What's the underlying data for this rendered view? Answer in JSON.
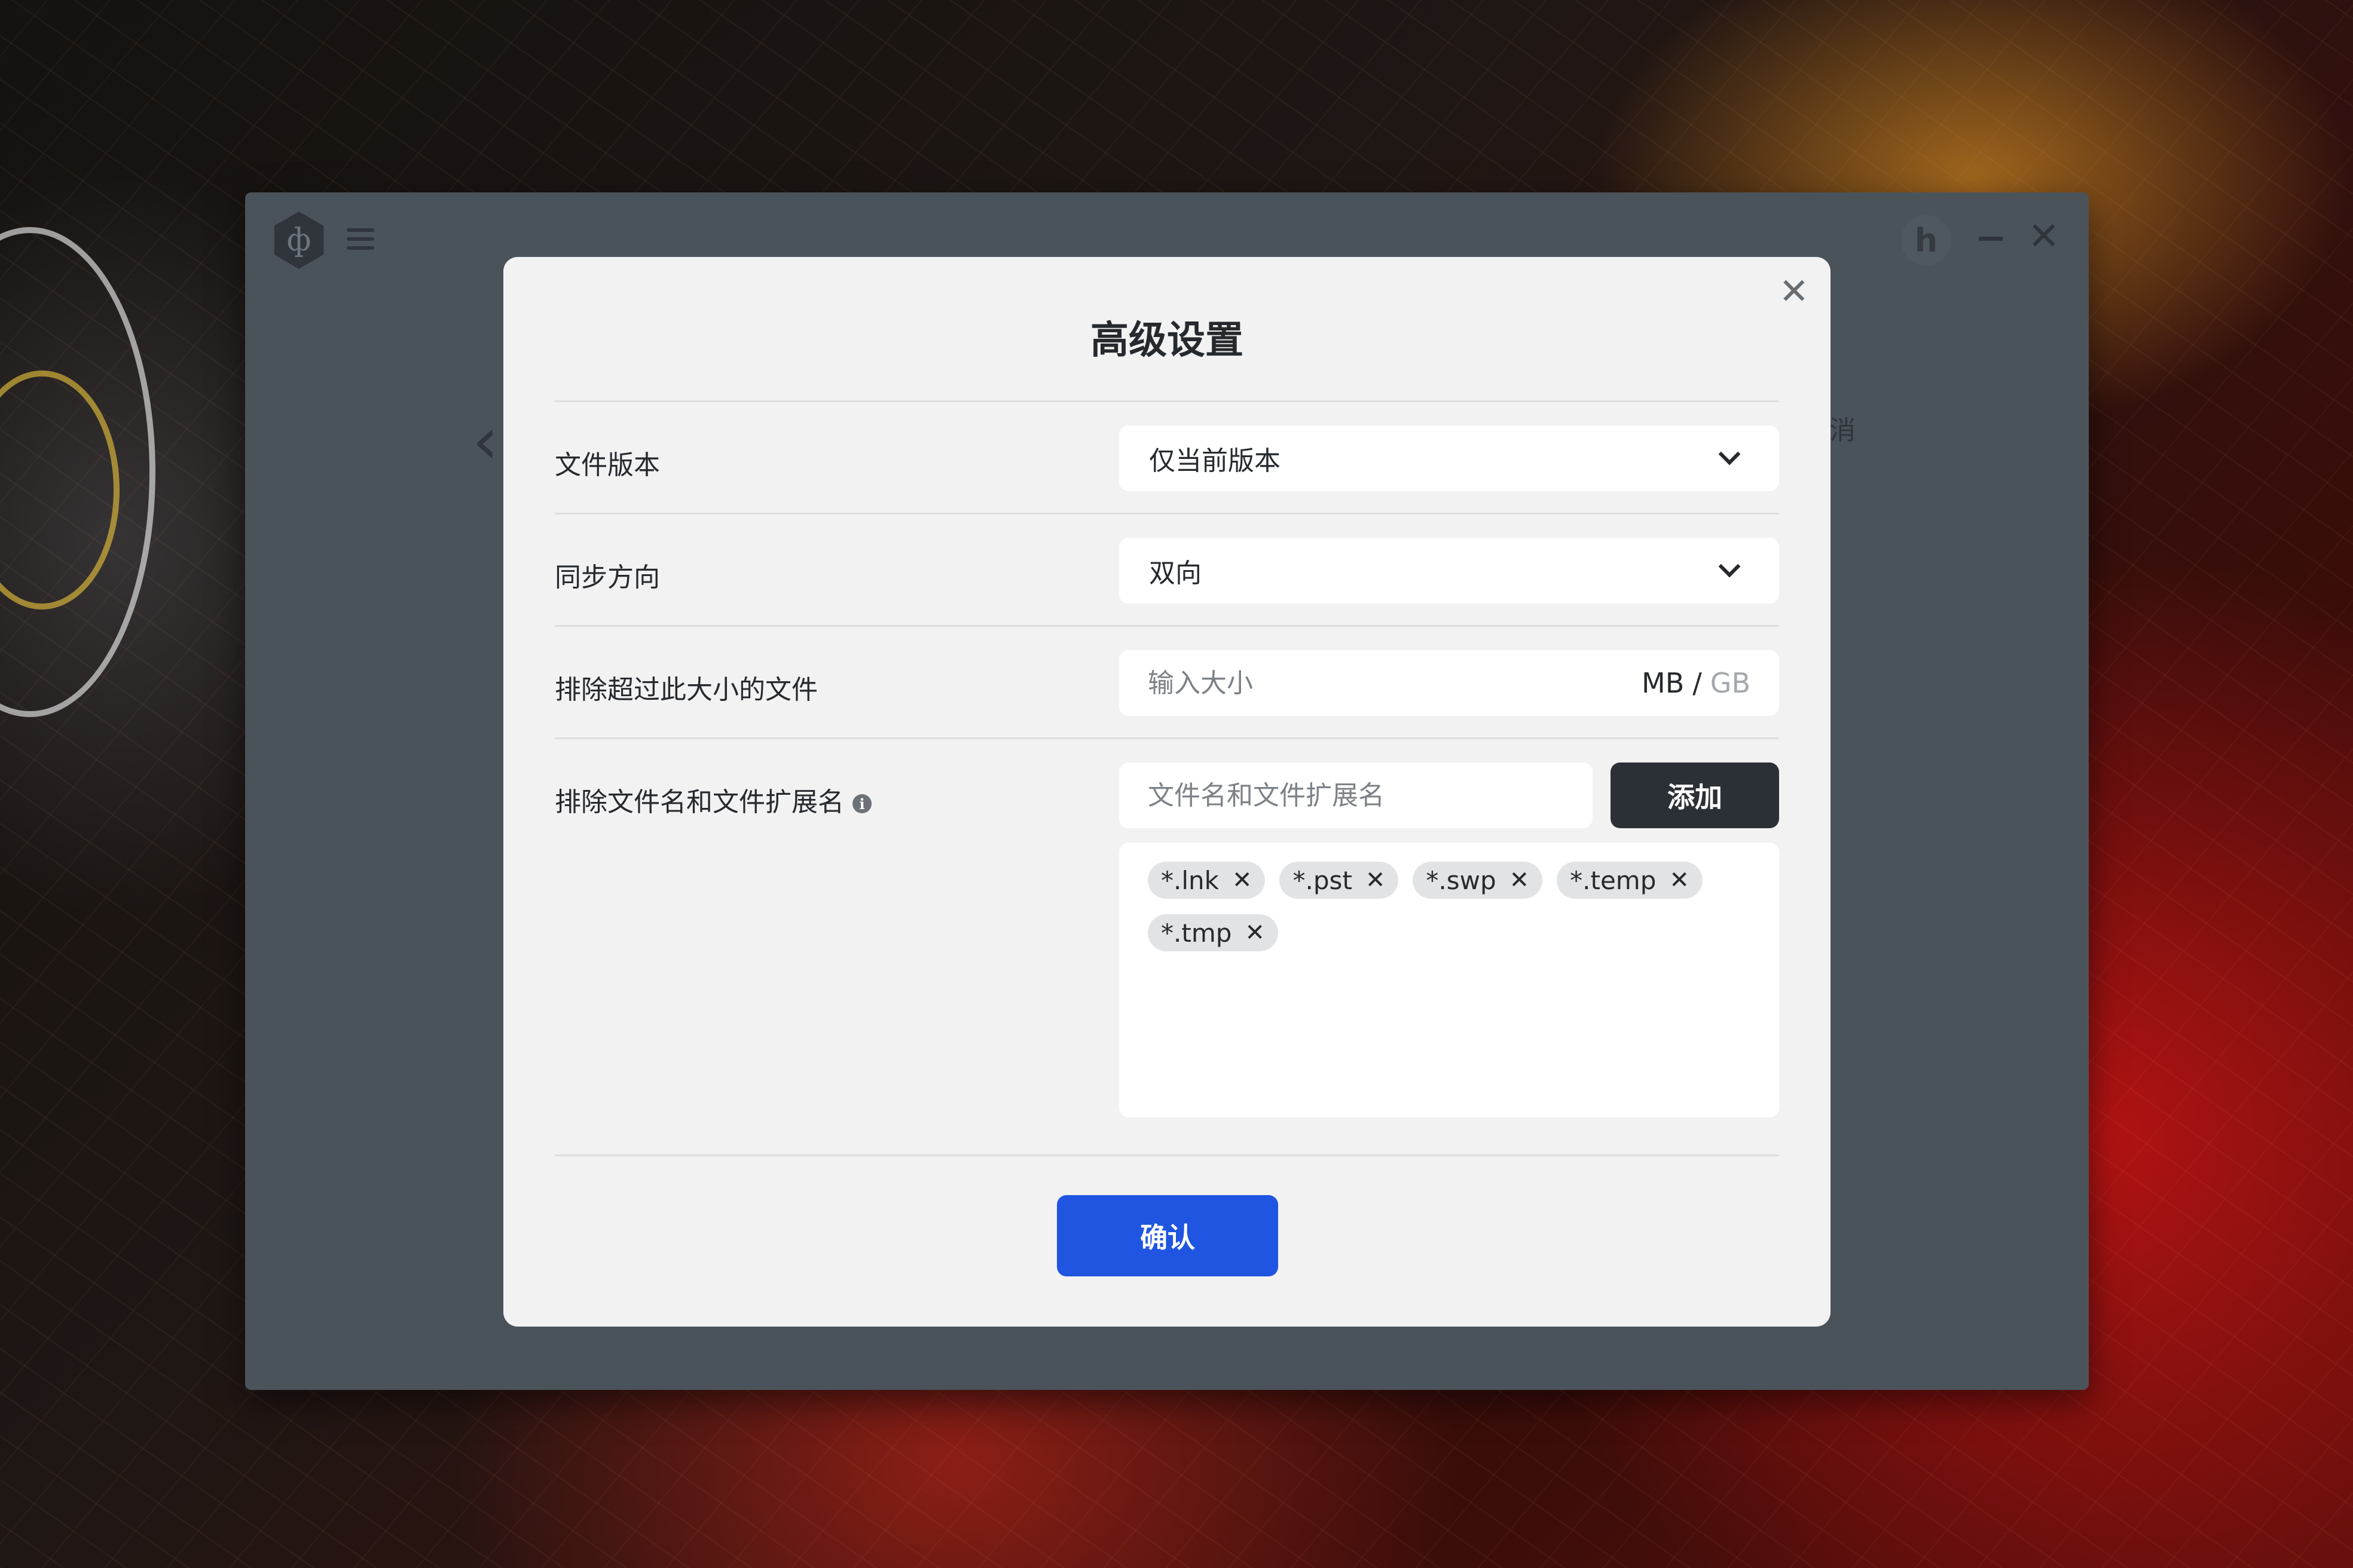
{
  "app": {
    "logo_glyph": "ф",
    "avatar_letter": "h",
    "behind_text": "消",
    "back_glyph": "‹",
    "close_glyph": "✕"
  },
  "dialog": {
    "title": "高级设置",
    "close_glyph": "✕",
    "file_version": {
      "label": "文件版本",
      "value": "仅当前版本"
    },
    "sync_direction": {
      "label": "同步方向",
      "value": "双向"
    },
    "size_limit": {
      "label": "排除超过此大小的文件",
      "placeholder": "输入大小",
      "unit_mb": "MB",
      "unit_sep": "/",
      "unit_gb": "GB",
      "selected_unit": "MB"
    },
    "exclude_names": {
      "label": "排除文件名和文件扩展名",
      "info_glyph": "i",
      "placeholder": "文件名和文件扩展名",
      "add_label": "添加",
      "tags": [
        "*.lnk",
        "*.pst",
        "*.swp",
        "*.temp",
        "*.tmp"
      ],
      "tag_remove_glyph": "✕"
    },
    "confirm_label": "确认"
  },
  "colors": {
    "primary": "#1f55e0",
    "dark_button": "#2b3036",
    "dialog_bg": "#f2f2f2",
    "window_bg": "#4b535a"
  }
}
